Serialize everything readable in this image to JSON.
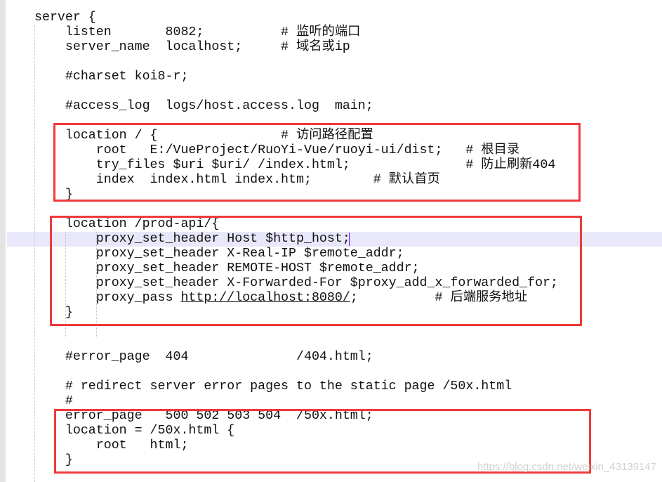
{
  "editor": {
    "lines": [
      "server {",
      "    listen       8082;          # 监听的端口",
      "    server_name  localhost;     # 域名或ip",
      "",
      "    #charset koi8-r;",
      "",
      "    #access_log  logs/host.access.log  main;",
      "",
      "    location / {                # 访问路径配置",
      "        root   E:/VueProject/RuoYi-Vue/ruoyi-ui/dist;   # 根目录",
      "        try_files $uri $uri/ /index.html;               # 防止刷新404",
      "        index  index.html index.htm;        # 默认首页",
      "    }",
      "",
      "    location /prod-api/{",
      "        proxy_set_header Host $http_host;",
      "        proxy_set_header X-Real-IP $remote_addr;",
      "        proxy_set_header REMOTE-HOST $remote_addr;",
      "        proxy_set_header X-Forwarded-For $proxy_add_x_forwarded_for;",
      "",
      "    }",
      "",
      "",
      "    #error_page  404              /404.html;",
      "",
      "    # redirect server error pages to the static page /50x.html",
      "    #",
      "    error_page   500 502 503 504  /50x.html;",
      "    location = /50x.html {",
      "        root   html;",
      "    }"
    ],
    "proxy_pass_line": {
      "prefix": "        proxy_pass ",
      "url": "http://localhost:8080/",
      "suffix": ";          # 后端服务地址"
    },
    "highlight_color": "#e8e8fa",
    "box_color": "#f03a3a"
  },
  "watermark": "https://blog.csdn.net/weixin_43139147"
}
